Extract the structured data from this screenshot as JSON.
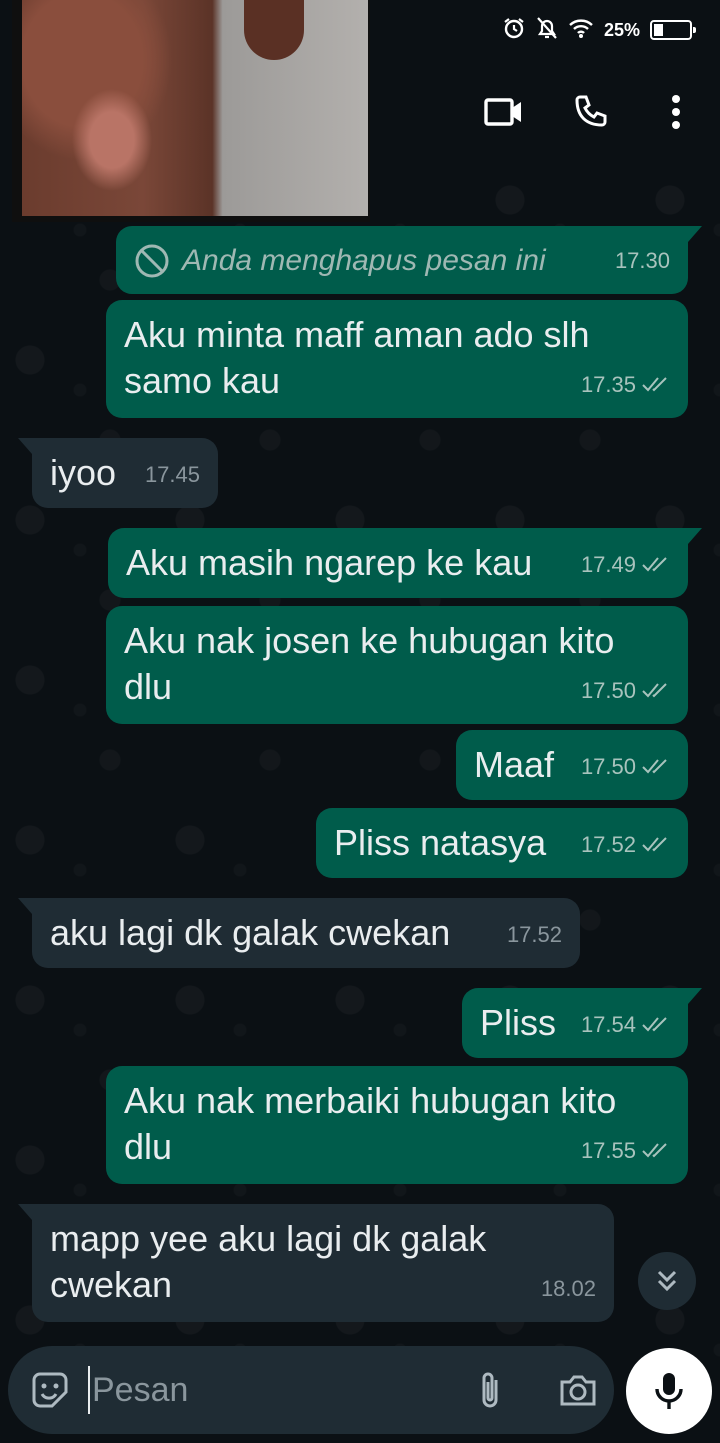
{
  "status_bar": {
    "battery": "25%",
    "icons": [
      "alarm-icon",
      "notifications-off-icon",
      "wifi-icon",
      "battery-icon"
    ]
  },
  "header": {
    "actions": [
      "video-call-icon",
      "voice-call-icon",
      "more-options-icon"
    ]
  },
  "messages": [
    {
      "direction": "out",
      "text": "Anda menghapus pesan ini",
      "time": "17.30",
      "deleted": true
    },
    {
      "direction": "out",
      "text": "Aku minta maff aman ado slh samo kau",
      "time": "17.35"
    },
    {
      "direction": "in",
      "text": "iyoo",
      "time": "17.45"
    },
    {
      "direction": "out",
      "text": "Aku masih ngarep ke kau",
      "time": "17.49"
    },
    {
      "direction": "out",
      "text": "Aku nak josen ke hubugan kito dlu",
      "time": "17.50"
    },
    {
      "direction": "out",
      "text": "Maaf",
      "time": "17.50"
    },
    {
      "direction": "out",
      "text": "Pliss natasya",
      "time": "17.52"
    },
    {
      "direction": "in",
      "text": "aku lagi dk galak cwekan",
      "time": "17.52"
    },
    {
      "direction": "out",
      "text": "Pliss",
      "time": "17.54"
    },
    {
      "direction": "out",
      "text": "Aku nak merbaiki hubugan kito dlu",
      "time": "17.55"
    },
    {
      "direction": "in",
      "text": "mapp yee aku lagi dk galak cwekan",
      "time": "18.02"
    }
  ],
  "composer": {
    "placeholder": "Pesan"
  },
  "colors": {
    "outgoing_bubble": "#005c4b",
    "incoming_bubble": "#1f2c34",
    "background": "#0b1014"
  }
}
